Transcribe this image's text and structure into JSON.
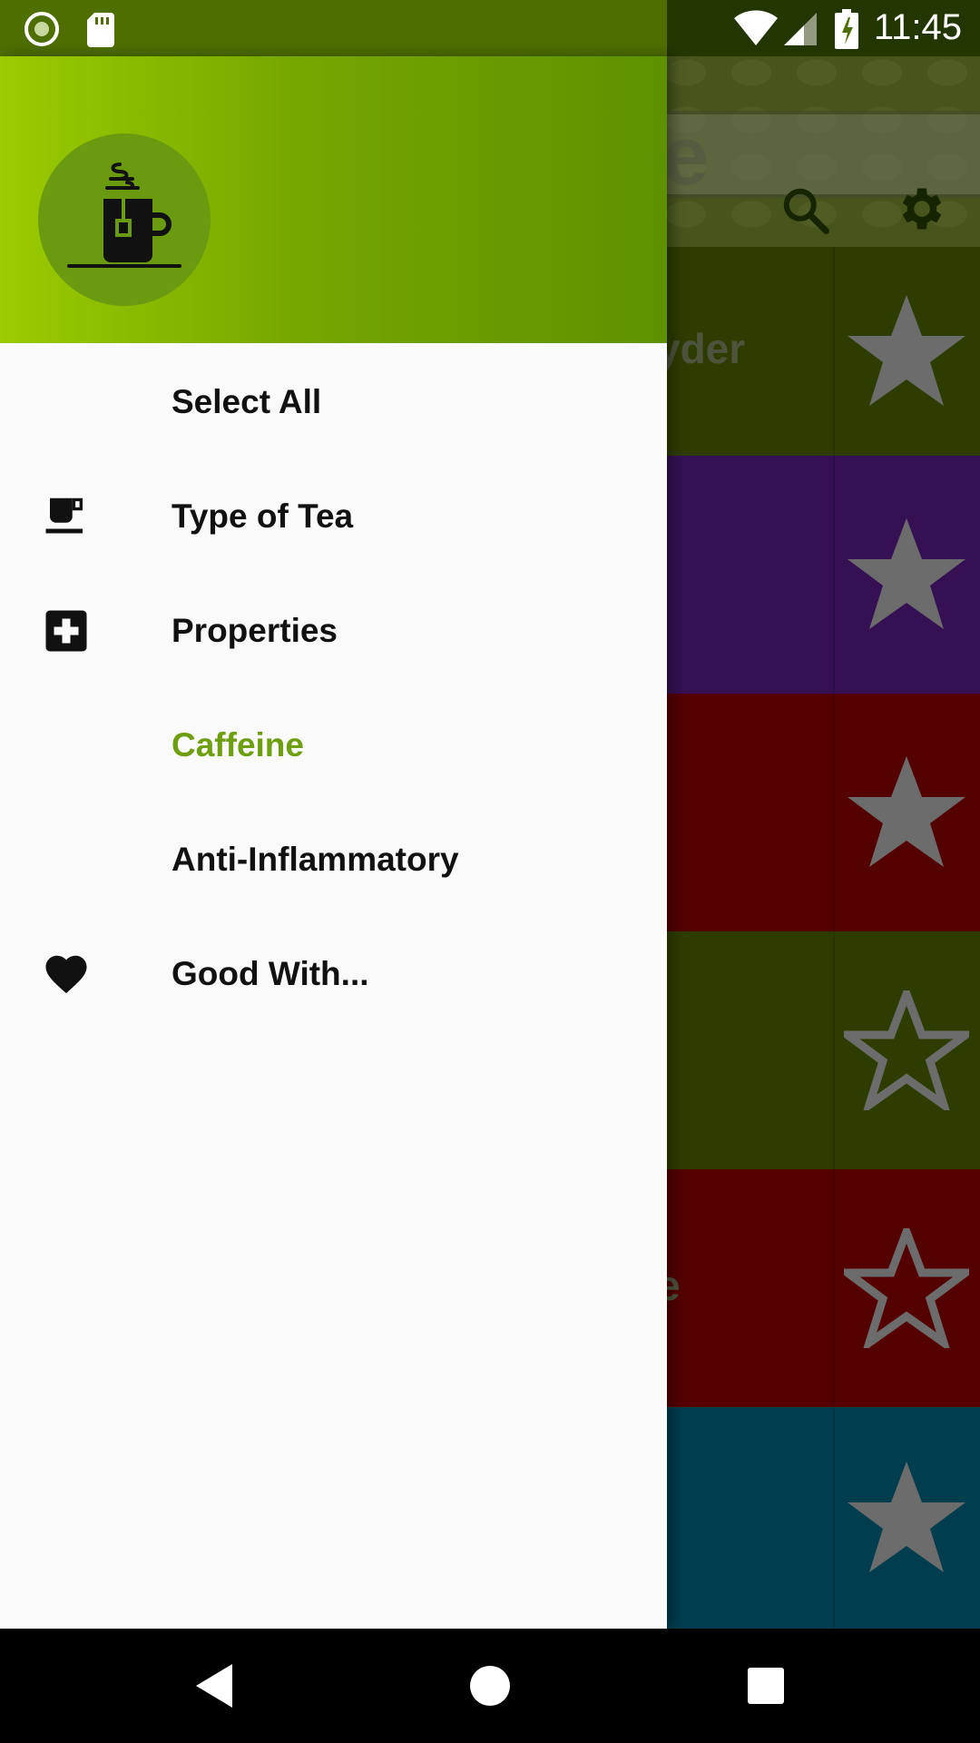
{
  "status_bar": {
    "time": "11:45",
    "left_icons": [
      "record-icon",
      "sd-card-icon"
    ],
    "right_icons": [
      "wifi-icon",
      "signal-icon",
      "battery-charging-icon"
    ]
  },
  "background_app": {
    "title_fragment": "e",
    "toolbar_icons": [
      "search-icon",
      "settings-gear-icon"
    ],
    "rows": [
      {
        "color": "#5a7a00",
        "text": "yder",
        "star": "filled"
      },
      {
        "color": "#6a22a8",
        "text": "",
        "star": "filled"
      },
      {
        "color": "#a80000",
        "text": "",
        "star": "filled"
      },
      {
        "color": "#5a7a00",
        "text": "",
        "star": "outline"
      },
      {
        "color": "#a80000",
        "text": "e",
        "star": "outline"
      },
      {
        "color": "#007a9e",
        "text": "",
        "star": "filled"
      }
    ]
  },
  "drawer": {
    "header_icon": "tea-cup-icon",
    "menu": [
      {
        "label": "Select All",
        "icon": "",
        "active": false
      },
      {
        "label": "Type of Tea",
        "icon": "cup-icon",
        "active": false
      },
      {
        "label": "Properties",
        "icon": "medical-plus-icon",
        "active": false
      },
      {
        "label": "Caffeine",
        "icon": "",
        "active": true
      },
      {
        "label": "Anti-Inflammatory",
        "icon": "",
        "active": false
      },
      {
        "label": "Good With...",
        "icon": "heart-icon",
        "active": false
      }
    ]
  },
  "colors": {
    "accent": "#6d9f10",
    "header_gradient_start": "#9bcb00",
    "header_gradient_end": "#5e9100"
  },
  "nav_bar": [
    "back-icon",
    "home-icon",
    "recents-icon"
  ]
}
